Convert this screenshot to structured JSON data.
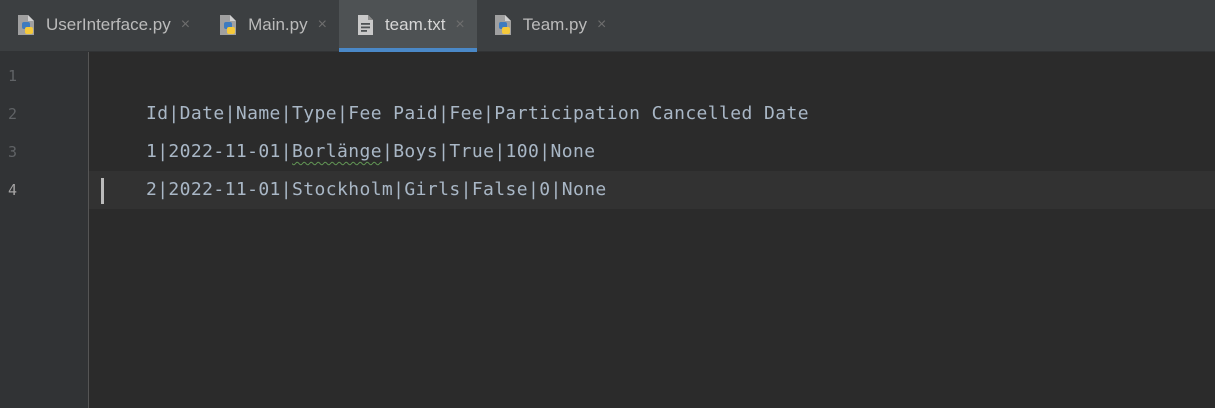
{
  "tabs": [
    {
      "label": "UserInterface.py",
      "icon": "python-file-icon",
      "active": false
    },
    {
      "label": "Main.py",
      "icon": "python-file-icon",
      "active": false
    },
    {
      "label": "team.txt",
      "icon": "text-file-icon",
      "active": true
    },
    {
      "label": "Team.py",
      "icon": "python-file-icon",
      "active": false
    }
  ],
  "close_glyph": "×",
  "editor": {
    "line_numbers": [
      "1",
      "2",
      "3",
      "4"
    ],
    "current_line": "4",
    "lines": [
      "Id|Date|Name|Type|Fee Paid|Fee|Participation Cancelled Date",
      {
        "pre": "1|2022-11-01|",
        "flagged": "Borlänge",
        "post": "|Boys|True|100|None"
      },
      "2|2022-11-01|Stockholm|Girls|False|0|None",
      ""
    ]
  },
  "colors": {
    "background": "#2b2b2b",
    "tab_bar": "#3c3f41",
    "active_tab": "#4e5254",
    "accent": "#4a88c7",
    "text": "#a9b7c6",
    "spellcheck_underline": "#629755"
  }
}
